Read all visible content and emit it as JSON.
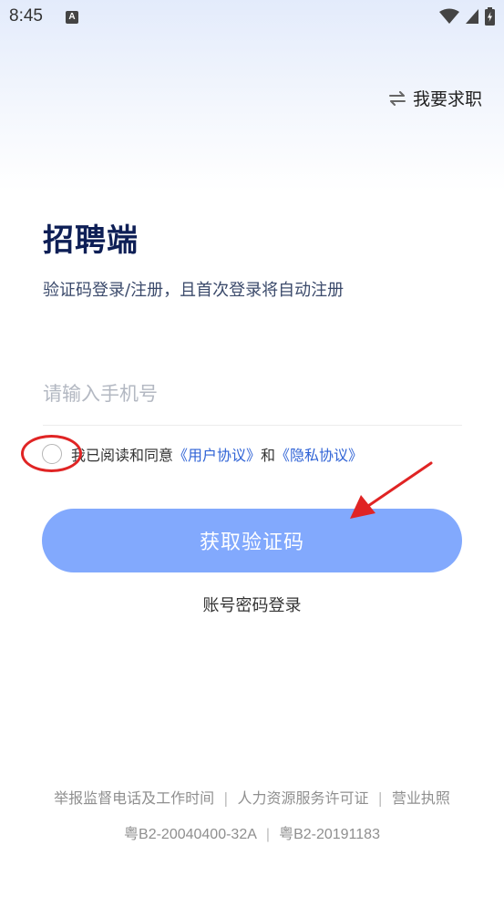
{
  "status_bar": {
    "time": "8:45",
    "notification_letter": "A"
  },
  "header": {
    "switch_role_label": "我要求职"
  },
  "main": {
    "title": "招聘端",
    "subtitle": "验证码登录/注册，且首次登录将自动注册",
    "phone_input": {
      "placeholder": "请输入手机号",
      "value": ""
    },
    "agreement": {
      "prefix": "我已阅读和同意",
      "user_agreement": "《用户协议》",
      "conjunction": "和",
      "privacy_policy": "《隐私协议》",
      "checked": false
    },
    "get_code_button": "获取验证码",
    "password_login_link": "账号密码登录"
  },
  "footer": {
    "links": [
      "举报监督电话及工作时间",
      "人力资源服务许可证",
      "营业执照"
    ],
    "separator": "|",
    "licenses": [
      "粤B2-20040400-32A",
      "粤B2-20191183"
    ]
  },
  "colors": {
    "primary_button": "#82a9fd",
    "link": "#2f63d6",
    "title": "#0e1f56",
    "annotation": "#e02424"
  }
}
